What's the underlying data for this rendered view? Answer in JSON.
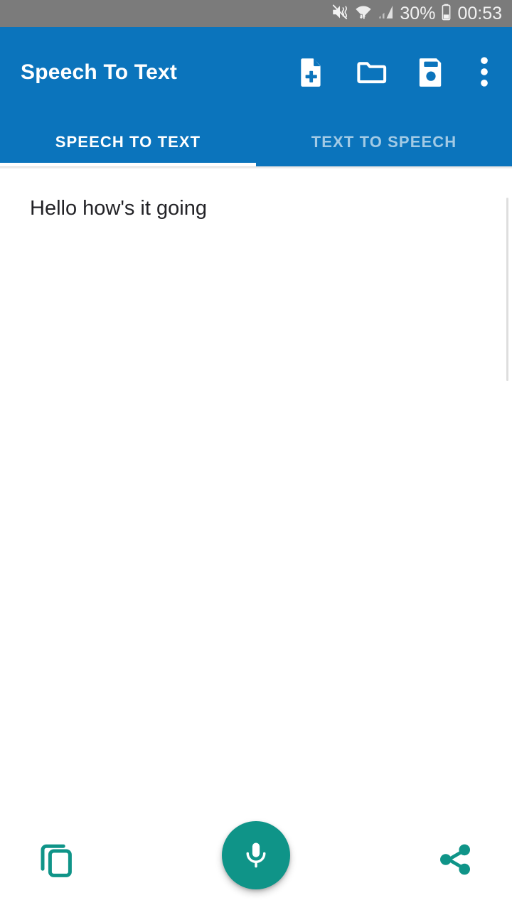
{
  "status_bar": {
    "battery_percent": "30%",
    "clock": "00:53",
    "icons": [
      "mute-vibrate-icon",
      "wifi-icon",
      "cellular-signal-icon",
      "battery-icon"
    ],
    "background_color": "#7b7b7b"
  },
  "app_bar": {
    "title": "Speech To Text",
    "background_color": "#0b74bc",
    "actions": [
      {
        "name": "new-document-icon",
        "label": "New"
      },
      {
        "name": "folder-icon",
        "label": "Open"
      },
      {
        "name": "save-icon",
        "label": "Save"
      },
      {
        "name": "overflow-menu-icon",
        "label": "More options"
      }
    ]
  },
  "tabs": {
    "items": [
      {
        "label": "Speech To Text",
        "active": true
      },
      {
        "label": "Text To Speech",
        "active": false
      }
    ],
    "indicator_color": "#ffffff"
  },
  "content": {
    "transcript_text": "Hello how's it going",
    "placeholder": "",
    "text_color": "#222226",
    "background_color": "#ffffff"
  },
  "bottom_bar": {
    "accent_color": "#0f9488",
    "copy_button": {
      "name": "copy-icon",
      "label": "Copy"
    },
    "mic_button": {
      "name": "microphone-icon",
      "label": "Record"
    },
    "share_button": {
      "name": "share-icon",
      "label": "Share"
    }
  }
}
